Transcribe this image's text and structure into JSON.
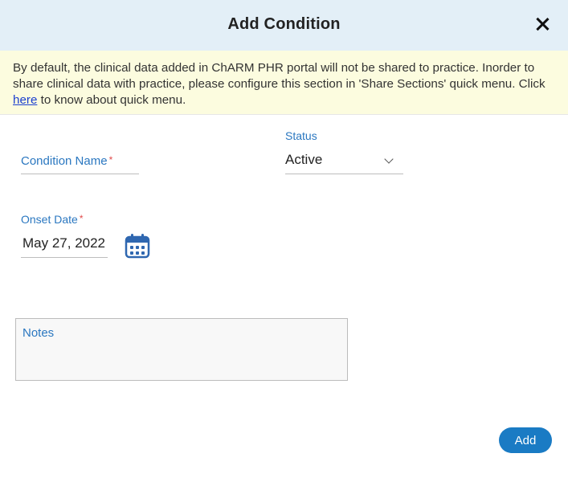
{
  "dialog": {
    "title": "Add Condition"
  },
  "notice": {
    "text_before": "By default, the clinical data added in ChARM PHR portal will not be shared to practice. Inorder to share clinical data with practice, please configure this section in 'Share Sections' quick menu. Click ",
    "link_text": "here",
    "text_after": " to know about quick menu."
  },
  "form": {
    "condition_name_label": "Condition Name",
    "required_mark": "*",
    "status_label": "Status",
    "status_value": "Active",
    "onset_date_label": "Onset Date",
    "onset_date_value": "May 27, 2022",
    "notes_label": "Notes"
  },
  "actions": {
    "add_label": "Add"
  },
  "icons": {
    "close": "close-icon",
    "dropdown": "chevron-down-icon",
    "calendar": "calendar-icon"
  },
  "colors": {
    "header_bg": "#e3eff7",
    "notice_bg": "#fcfcdf",
    "accent": "#1a7bc4",
    "label_blue": "#2a77c0",
    "required_red": "#e14b4b"
  }
}
